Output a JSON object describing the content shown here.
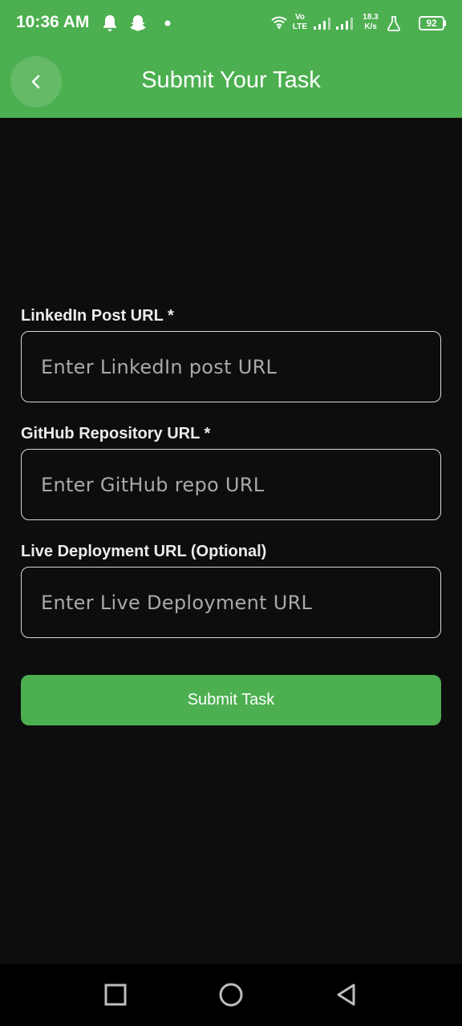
{
  "status_bar": {
    "time": "10:36 AM",
    "net_top": "Vo",
    "net_bottom": "LTE",
    "speed_value": "18.3",
    "speed_unit": "K/s",
    "battery": "92"
  },
  "app_bar": {
    "title": "Submit Your Task",
    "back_icon": "chevron-left-icon"
  },
  "form": {
    "linkedin": {
      "label": "LinkedIn Post URL *",
      "placeholder": "Enter LinkedIn post URL",
      "value": ""
    },
    "github": {
      "label": "GitHub Repository URL *",
      "placeholder": "Enter GitHub repo URL",
      "value": ""
    },
    "live": {
      "label": "Live Deployment URL (Optional)",
      "placeholder": "Enter Live Deployment URL",
      "value": ""
    },
    "submit_label": "Submit Task"
  },
  "nav_bar": {
    "icons": [
      "square-recents-icon",
      "circle-home-icon",
      "triangle-back-icon"
    ]
  },
  "colors": {
    "accent": "#4caf50",
    "background": "#0d0d0d",
    "nav_background": "#000000"
  }
}
